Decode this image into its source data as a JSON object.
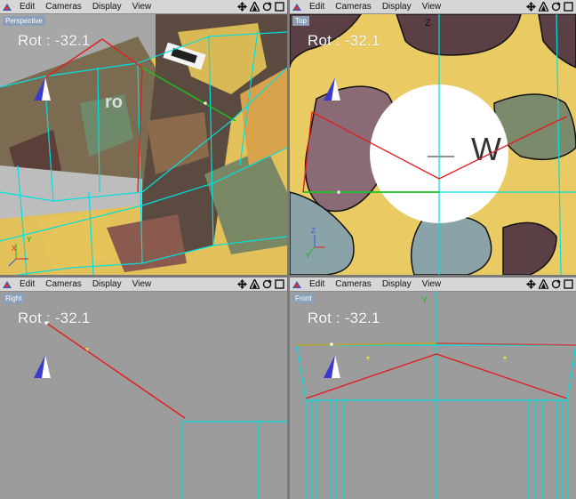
{
  "colors": {
    "menubar_bg": "#d6d6d6",
    "viewport_bg": "#9c9c9c",
    "label_bg": "#8aa0b8",
    "wire_cyan": "#00e0e0",
    "wire_red": "#e02020",
    "wire_green": "#20c020",
    "camo_yellow": "#e6c45a"
  },
  "menu": {
    "edit": "Edit",
    "cameras": "Cameras",
    "display": "Display",
    "view": "View"
  },
  "viewports": {
    "perspective": {
      "label": "Perspective",
      "rot": "Rot : -32.1"
    },
    "top": {
      "label": "Top",
      "rot": "Rot : -32.1",
      "axis_z": "Z",
      "decal_letter": "W"
    },
    "right": {
      "label": "Right",
      "rot": "Rot : -32.1"
    },
    "front": {
      "label": "Front",
      "rot": "Rot : -32.1",
      "axis_y": "Y"
    }
  },
  "icons": {
    "logo": "wings3d-logo-icon",
    "move": "move-arrows-icon",
    "zoom": "zoom-triangle-icon",
    "rotate": "rotate-icon",
    "maximize": "maximize-icon",
    "camera_gizmo": "camera-cone-icon"
  }
}
